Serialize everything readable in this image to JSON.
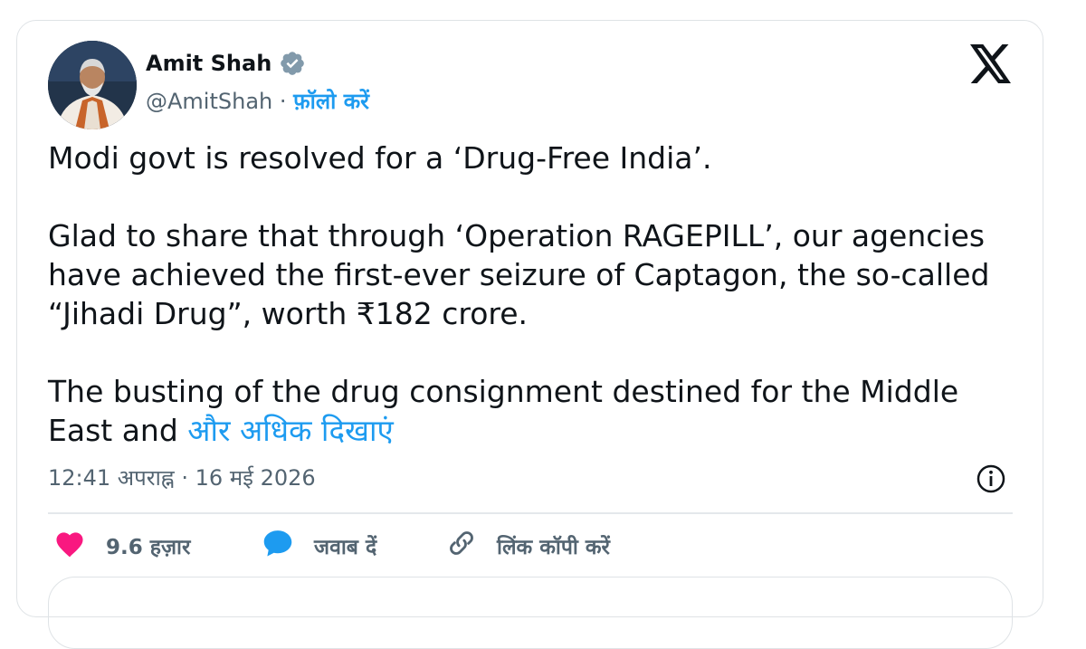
{
  "author": {
    "name": "Amit Shah",
    "handle": "@AmitShah",
    "separator": "·",
    "follow_label": "फ़ॉलो करें",
    "verified": true,
    "verified_color": "#829aab"
  },
  "tweet": {
    "paragraphs": [
      "Modi govt is resolved for a ‘Drug-Free India’.",
      "Glad to share that through ‘Operation RAGEPILL’, our agencies have achieved the first-ever seizure of Captagon, the so-called “Jihadi Drug”, worth ₹182 crore."
    ],
    "truncated_text": "The busting of the drug consignment destined for the Middle East and",
    "show_more_label": "और अधिक दिखाएं"
  },
  "meta": {
    "time": "12:41 अपराह्न",
    "separator": "·",
    "date": "16 मई 2026"
  },
  "actions": {
    "like_count": "9.6 हज़ार",
    "reply_label": "जवाब दें",
    "copy_link_label": "लिंक कॉपी करें"
  },
  "icons": {
    "platform": "x-logo-icon",
    "verified": "verified-badge-icon",
    "info": "info-icon",
    "like": "heart-icon",
    "reply": "speech-bubble-icon",
    "copy_link": "link-icon"
  },
  "colors": {
    "accent": "#1d9bf0",
    "like": "#f91880",
    "text": "#0f1419",
    "secondary_text": "#536471",
    "border": "#dfe3e6"
  }
}
